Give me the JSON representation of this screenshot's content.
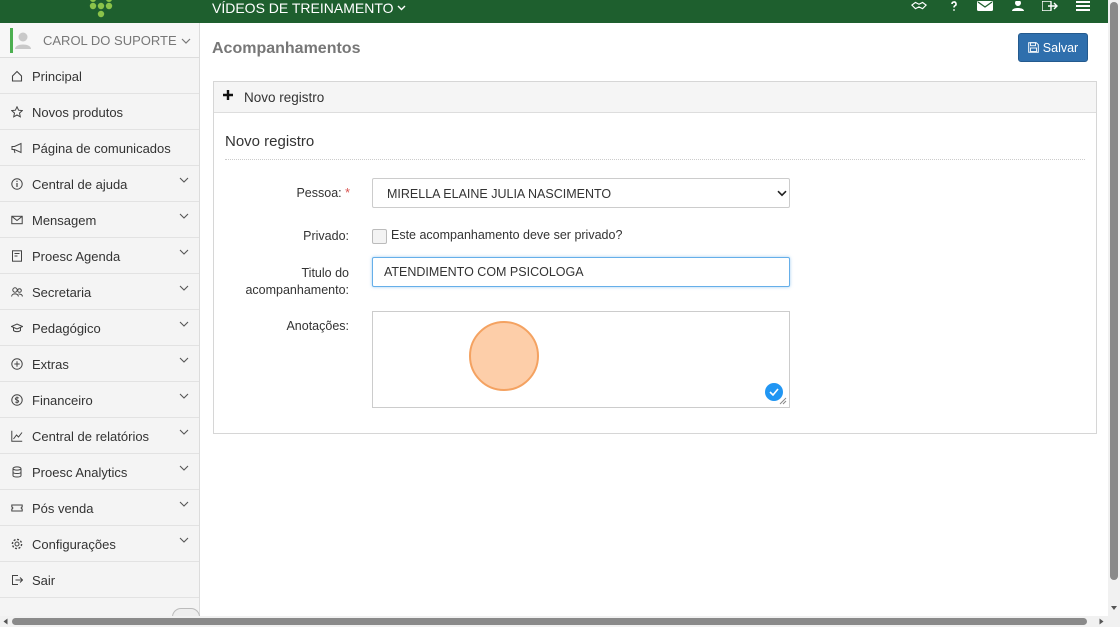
{
  "topbar": {
    "title": "VÍDEOS DE TREINAMENTO",
    "icons": [
      "handshake-icon",
      "help-icon",
      "mail-icon",
      "user-icon",
      "logout-icon",
      "menu-icon"
    ],
    "color": "#1e5f2e"
  },
  "sidebar": {
    "user_name": "CAROL DO SUPORTE",
    "items": [
      {
        "label": "Principal",
        "icon": "home-icon",
        "expandable": false
      },
      {
        "label": "Novos produtos",
        "icon": "star-icon",
        "expandable": false
      },
      {
        "label": "Página de comunicados",
        "icon": "megaphone-icon",
        "expandable": false
      },
      {
        "label": "Central de ajuda",
        "icon": "info-icon",
        "expandable": true
      },
      {
        "label": "Mensagem",
        "icon": "envelope-icon",
        "expandable": true
      },
      {
        "label": "Proesc Agenda",
        "icon": "agenda-icon",
        "expandable": true
      },
      {
        "label": "Secretaria",
        "icon": "users-icon",
        "expandable": true
      },
      {
        "label": "Pedagógico",
        "icon": "graduation-cap-icon",
        "expandable": true
      },
      {
        "label": "Extras",
        "icon": "plus-circle-icon",
        "expandable": true
      },
      {
        "label": "Financeiro",
        "icon": "dollar-icon",
        "expandable": true
      },
      {
        "label": "Central de relatórios",
        "icon": "line-chart-icon",
        "expandable": true
      },
      {
        "label": "Proesc Analytics",
        "icon": "database-icon",
        "expandable": true
      },
      {
        "label": "Pós venda",
        "icon": "ticket-icon",
        "expandable": true
      },
      {
        "label": "Configurações",
        "icon": "gear-icon",
        "expandable": true
      },
      {
        "label": "Sair",
        "icon": "exit-icon",
        "expandable": false
      }
    ]
  },
  "main": {
    "page_title": "Acompanhamentos",
    "save_label": "Salvar",
    "accent_color": "#2f6fad",
    "panel_header": "Novo registro",
    "section_title": "Novo registro",
    "form": {
      "pessoa_label": "Pessoa:",
      "required_mark": "*",
      "pessoa_value": "MIRELLA ELAINE JULIA NASCIMENTO",
      "privado_label": "Privado:",
      "privado_text": "Este acompanhamento deve ser privado?",
      "privado_checked": false,
      "titulo_label_1": "Titulo do",
      "titulo_label_2": "acompanhamento:",
      "titulo_value": "ATENDIMENTO COM PSICOLOGA",
      "anotacoes_label": "Anotações:",
      "anotacoes_value": ""
    }
  }
}
